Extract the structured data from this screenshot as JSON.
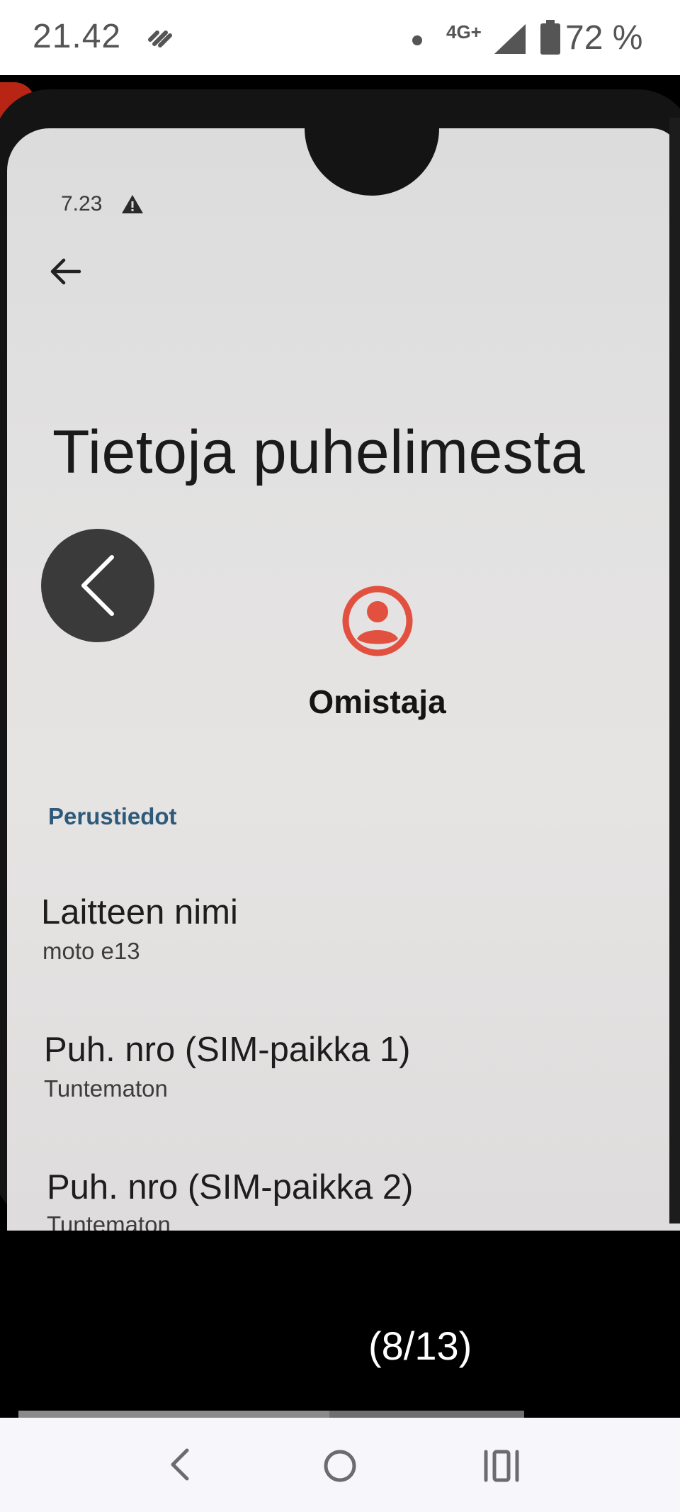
{
  "status_bar": {
    "time": "21.42",
    "network": "4G+",
    "battery": "72 %",
    "icons": [
      "app-notification-icon",
      "dot-icon",
      "signal-icon",
      "battery-icon"
    ]
  },
  "photo": {
    "inner_status": {
      "time": "7.23",
      "icon": "warning-icon"
    },
    "back_icon": "arrow-left-icon",
    "title": "Tietoja puhelimesta",
    "owner": {
      "icon": "account-circle-icon",
      "accent_color": "#e2503f",
      "label": "Omistaja"
    },
    "section_header": "Perustiedot",
    "section_color": "#2e5a7a",
    "items": [
      {
        "title": "Laitteen nimi",
        "subtitle": "moto e13"
      },
      {
        "title": "Puh. nro (SIM-paikka 1)",
        "subtitle": "Tuntematon"
      },
      {
        "title": "Puh. nro (SIM-paikka 2)",
        "subtitle": "Tuntematon"
      }
    ]
  },
  "viewer": {
    "prev_icon": "chevron-left-icon",
    "counter": "(8/13)",
    "progress_fraction": 0.615
  },
  "nav_bar": {
    "icons": [
      "nav-back-icon",
      "nav-home-icon",
      "nav-recents-icon"
    ]
  }
}
